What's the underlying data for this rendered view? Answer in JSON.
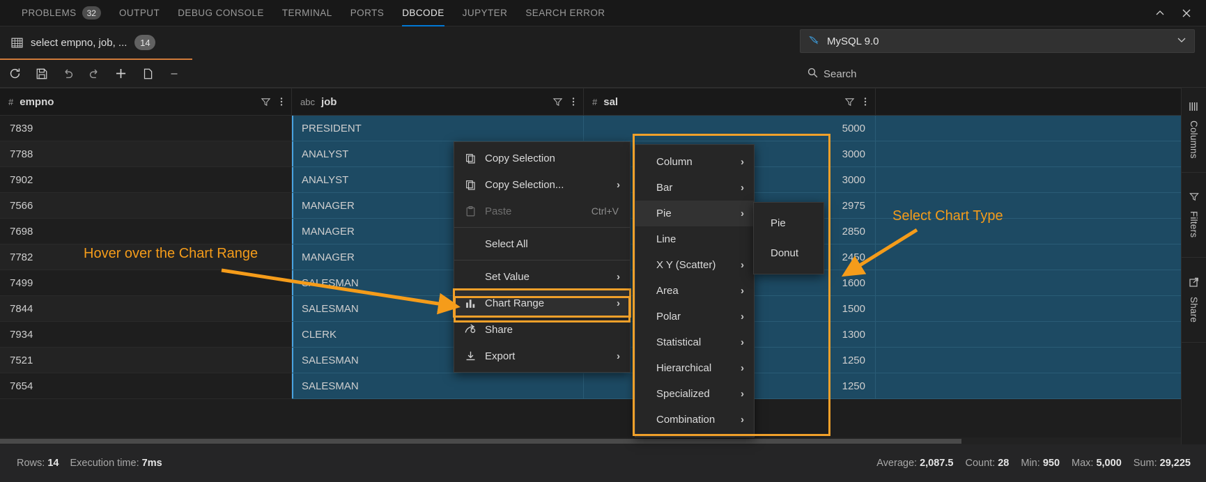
{
  "panel": {
    "tabs": [
      {
        "label": "PROBLEMS",
        "badge": "32",
        "active": false
      },
      {
        "label": "OUTPUT",
        "badge": "",
        "active": false
      },
      {
        "label": "DEBUG CONSOLE",
        "badge": "",
        "active": false
      },
      {
        "label": "TERMINAL",
        "badge": "",
        "active": false
      },
      {
        "label": "PORTS",
        "badge": "",
        "active": false
      },
      {
        "label": "DBCODE",
        "badge": "",
        "active": true
      },
      {
        "label": "JUPYTER",
        "badge": "",
        "active": false
      },
      {
        "label": "SEARCH ERROR",
        "badge": "",
        "active": false
      }
    ],
    "chevron_up_title": "Maximize Panel Size",
    "close_title": "Close Panel"
  },
  "query_tab": {
    "title": "select empno, job, ...",
    "row_badge": "14"
  },
  "toolbar": {
    "buttons": [
      {
        "name": "refresh-button",
        "glyph": "refresh"
      },
      {
        "name": "save-button",
        "glyph": "save"
      },
      {
        "name": "undo-button",
        "glyph": "undo"
      },
      {
        "name": "redo-button",
        "glyph": "redo"
      },
      {
        "name": "add-row-button",
        "glyph": "plus"
      },
      {
        "name": "duplicate-row-button",
        "glyph": "copy"
      },
      {
        "name": "delete-row-button",
        "glyph": "minus"
      }
    ]
  },
  "connection": {
    "label": "MySQL 9.0",
    "icon": "dolphin-icon"
  },
  "search": {
    "placeholder": "Search",
    "value": ""
  },
  "grid": {
    "columns": [
      {
        "name": "empno",
        "type_icon": "#",
        "type": "number"
      },
      {
        "name": "job",
        "type_icon": "abc",
        "type": "text"
      },
      {
        "name": "sal",
        "type_icon": "#",
        "type": "number"
      }
    ],
    "rows": [
      {
        "empno": "7839",
        "job": "PRESIDENT",
        "sal": "5000"
      },
      {
        "empno": "7788",
        "job": "ANALYST",
        "sal": "3000"
      },
      {
        "empno": "7902",
        "job": "ANALYST",
        "sal": "3000"
      },
      {
        "empno": "7566",
        "job": "MANAGER",
        "sal": "2975"
      },
      {
        "empno": "7698",
        "job": "MANAGER",
        "sal": "2850"
      },
      {
        "empno": "7782",
        "job": "MANAGER",
        "sal": "2450"
      },
      {
        "empno": "7499",
        "job": "SALESMAN",
        "sal": "1600"
      },
      {
        "empno": "7844",
        "job": "SALESMAN",
        "sal": "1500"
      },
      {
        "empno": "7934",
        "job": "CLERK",
        "sal": "1300"
      },
      {
        "empno": "7521",
        "job": "SALESMAN",
        "sal": "1250"
      },
      {
        "empno": "7654",
        "job": "SALESMAN",
        "sal": "1250"
      }
    ]
  },
  "context_menu": {
    "items": [
      {
        "label": "Copy Selection",
        "icon": "copy-icon",
        "shortcut": "",
        "arrow": false,
        "disabled": false,
        "indent": false,
        "highlight": false,
        "sep_after": false
      },
      {
        "label": "Copy Selection...",
        "icon": "copy-icon",
        "shortcut": "",
        "arrow": true,
        "disabled": false,
        "indent": false,
        "highlight": false,
        "sep_after": false
      },
      {
        "label": "Paste",
        "icon": "clipboard-icon",
        "shortcut": "Ctrl+V",
        "arrow": false,
        "disabled": true,
        "indent": false,
        "highlight": false,
        "sep_after": true
      },
      {
        "label": "Select All",
        "icon": "",
        "shortcut": "",
        "arrow": false,
        "disabled": false,
        "indent": true,
        "highlight": false,
        "sep_after": true
      },
      {
        "label": "Set Value",
        "icon": "",
        "shortcut": "",
        "arrow": true,
        "disabled": false,
        "indent": true,
        "highlight": false,
        "sep_after": false
      },
      {
        "label": "Chart Range",
        "icon": "chart-bars-icon",
        "shortcut": "",
        "arrow": true,
        "disabled": false,
        "indent": false,
        "highlight": true,
        "sep_after": false
      },
      {
        "label": "Share",
        "icon": "share-icon",
        "shortcut": "",
        "arrow": false,
        "disabled": false,
        "indent": false,
        "highlight": false,
        "sep_after": false
      },
      {
        "label": "Export",
        "icon": "export-icon",
        "shortcut": "",
        "arrow": true,
        "disabled": false,
        "indent": false,
        "highlight": false,
        "sep_after": false
      }
    ]
  },
  "chart_submenu": {
    "items": [
      {
        "label": "Column",
        "arrow": true,
        "active": false
      },
      {
        "label": "Bar",
        "arrow": true,
        "active": false
      },
      {
        "label": "Pie",
        "arrow": true,
        "active": true
      },
      {
        "label": "Line",
        "arrow": false,
        "active": false
      },
      {
        "label": "X Y (Scatter)",
        "arrow": true,
        "active": false
      },
      {
        "label": "Area",
        "arrow": true,
        "active": false
      },
      {
        "label": "Polar",
        "arrow": true,
        "active": false
      },
      {
        "label": "Statistical",
        "arrow": true,
        "active": false
      },
      {
        "label": "Hierarchical",
        "arrow": true,
        "active": false
      },
      {
        "label": "Specialized",
        "arrow": true,
        "active": false
      },
      {
        "label": "Combination",
        "arrow": true,
        "active": false
      }
    ]
  },
  "pie_submenu": {
    "items": [
      {
        "label": "Pie"
      },
      {
        "label": "Donut"
      }
    ]
  },
  "rail": {
    "items": [
      {
        "label": "Columns",
        "icon": "columns-icon"
      },
      {
        "label": "Filters",
        "icon": "filter-icon"
      },
      {
        "label": "Share",
        "icon": "share-box-icon"
      }
    ]
  },
  "status": {
    "rows_label": "Rows:",
    "rows_value": "14",
    "exec_label": "Execution time:",
    "exec_value": "7ms",
    "avg_label": "Average:",
    "avg_value": "2,087.5",
    "count_label": "Count:",
    "count_value": "28",
    "min_label": "Min:",
    "min_value": "950",
    "max_label": "Max:",
    "max_value": "5,000",
    "sum_label": "Sum:",
    "sum_value": "29,225"
  },
  "annotations": {
    "hover_text": "Hover over the Chart Range",
    "select_text": "Select Chart Type",
    "accent": "#f0a02a"
  }
}
